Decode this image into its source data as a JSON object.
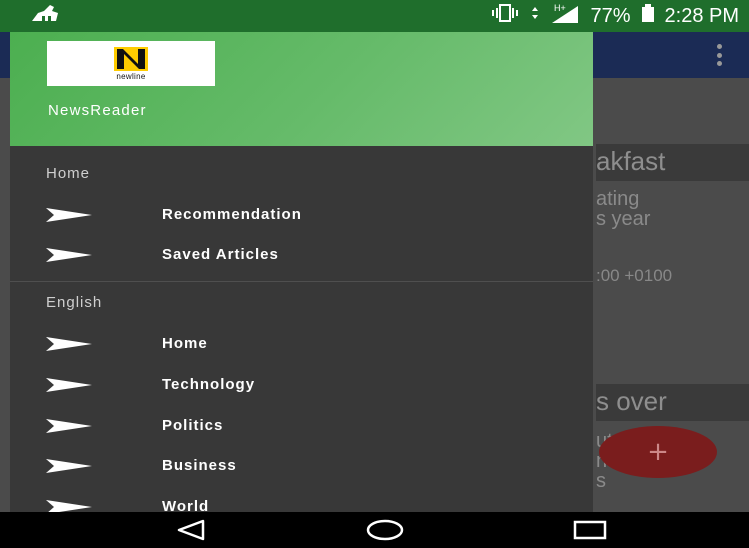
{
  "status_bar": {
    "battery_text": "77%",
    "time": "2:28 PM",
    "network": "H+",
    "icons": [
      "app-notification-icon",
      "vibrate-icon",
      "data-transfer-icon",
      "cellular-signal-icon",
      "battery-icon"
    ]
  },
  "background_app": {
    "card1": {
      "heading": "akfast",
      "sub1": "ating",
      "sub2": "s year",
      "date": ":00 +0100"
    },
    "card2": {
      "heading": "s over",
      "sub1": "ut",
      "sub2": "ns",
      "sub3": "s"
    },
    "fab_label": "+"
  },
  "drawer": {
    "logo_text": "newline",
    "app_name": "NewsReader",
    "sections": [
      {
        "title": "Home",
        "items": [
          {
            "label": "Recommendation",
            "icon": "send-icon"
          },
          {
            "label": "Saved Articles",
            "icon": "send-icon"
          }
        ]
      },
      {
        "title": "English",
        "items": [
          {
            "label": "Home",
            "icon": "send-icon"
          },
          {
            "label": "Technology",
            "icon": "send-icon"
          },
          {
            "label": "Politics",
            "icon": "send-icon"
          },
          {
            "label": "Business",
            "icon": "send-icon"
          },
          {
            "label": "World",
            "icon": "send-icon"
          }
        ]
      }
    ]
  },
  "colors": {
    "drawer_header_green": "#4caf50",
    "drawer_bg": "#383838",
    "status_bar_green": "#1f6e2c",
    "toolbar_navy": "#1b2b55",
    "fab_red": "#7a1d1d"
  },
  "nav_bar": {
    "icons": [
      "back-icon",
      "home-icon",
      "recents-icon"
    ]
  }
}
